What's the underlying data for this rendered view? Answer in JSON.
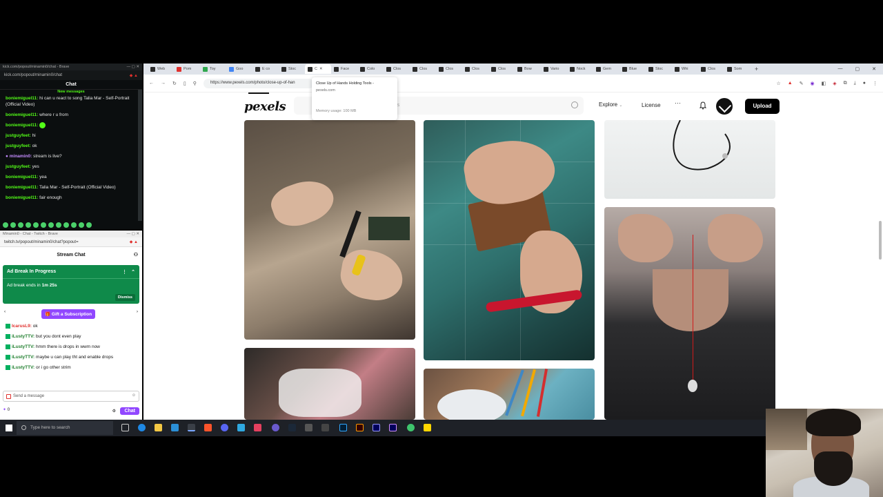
{
  "kick": {
    "title": "kick.com/popout/minamin0/chat - Brave",
    "url": "kick.com/popout/minamin0/chat",
    "chat_header": "Chat",
    "new_messages": "New messages",
    "messages": [
      {
        "user": "boniemiguel11:",
        "text": "hi can u react to song Talia Mar - Self-Portrait (Official Video)"
      },
      {
        "user": "boniemiguel11:",
        "text": "where r u from"
      },
      {
        "user": "boniemiguel11:",
        "text": ""
      },
      {
        "user": "justguyfeet:",
        "text": "hi"
      },
      {
        "user": "justguyfeet:",
        "text": "ok"
      },
      {
        "user": "minamin0:",
        "text": "stream is live?"
      },
      {
        "user": "justguyfeet:",
        "text": "yes"
      },
      {
        "user": "boniemiguel11:",
        "text": "yea"
      },
      {
        "user": "boniemiguel11:",
        "text": "Talia Mar - Self-Portrait (Official Video)"
      },
      {
        "user": "boniemiguel11:",
        "text": "fair enough"
      }
    ]
  },
  "twitch": {
    "title": "Minamin0 - Chat - Twitch - Brave",
    "url": "twitch.tv/popout/minamin0/chat?popout=",
    "chat_header": "Stream Chat",
    "ad_title": "Ad Break In Progress",
    "ad_body_prefix": "Ad break ends in ",
    "ad_time": "1m 25s",
    "dismiss": "Dismiss",
    "gift": "Gift a Subscription",
    "messages": [
      {
        "user": "IcarusL9:",
        "text": "ok",
        "red": true
      },
      {
        "user": "iLustyTTV:",
        "text": "but you dont even play",
        "red": false
      },
      {
        "user": "iLustyTTV:",
        "text": "hmm there is drops in wwm now",
        "red": false
      },
      {
        "user": "iLustyTTV:",
        "text": "maybe u can play tht and enable drops",
        "red": false
      },
      {
        "user": "iLustyTTV:",
        "text": "or i go other strim",
        "red": false
      }
    ],
    "input_placeholder": "Send a message",
    "points": "0",
    "chat_button": "Chat"
  },
  "browser": {
    "tabs": [
      "Web",
      "Pom",
      "Toy",
      "Goo",
      "E co",
      "Stoc",
      "C",
      "Face",
      "Colo",
      "Clos",
      "Clos",
      "Clos",
      "Clos",
      "Clos",
      "Bow",
      "Vario",
      "Nock",
      "Gem",
      "Blue",
      "Stoc",
      "Whi",
      "Clos",
      "Som"
    ],
    "active_tab_index": 6,
    "address": "https://www.pexels.com/photo/close-up-of-han",
    "tooltip_title": "Close Up of Hands Holding Tools -",
    "tooltip_url": "pexels.com",
    "tooltip_mem": "Memory usage: 100 MB"
  },
  "pexels": {
    "logo": "pexels",
    "search_placeholder": "otos",
    "explore": "Explore",
    "license": "License",
    "more": "···",
    "upload": "Upload"
  },
  "taskbar": {
    "search_placeholder": "Type here to search"
  }
}
